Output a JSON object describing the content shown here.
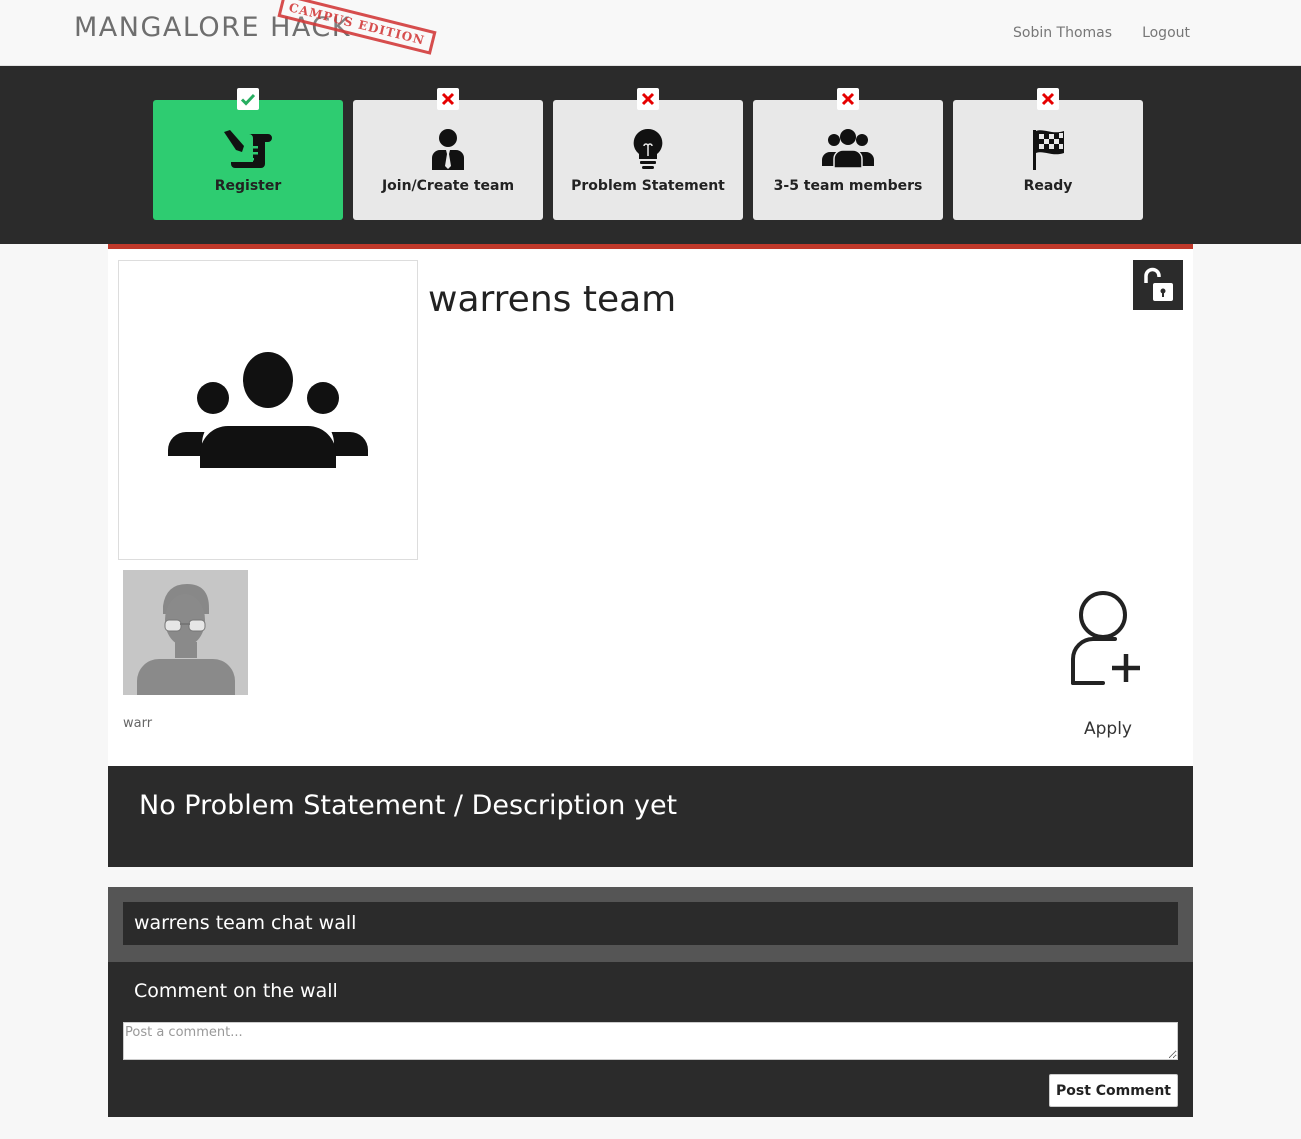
{
  "header": {
    "brand": "MANGALORE HACK",
    "stamp": "CAMPUS EDITION",
    "user_name": "Sobin Thomas",
    "logout_label": "Logout"
  },
  "steps": [
    {
      "label": "Register",
      "status": "done",
      "icon": "register-scroll-icon"
    },
    {
      "label": "Join/Create team",
      "status": "pending",
      "icon": "person-icon"
    },
    {
      "label": "Problem Statement",
      "status": "pending",
      "icon": "lightbulb-icon"
    },
    {
      "label": "3-5 team members",
      "status": "pending",
      "icon": "group-icon"
    },
    {
      "label": "Ready",
      "status": "pending",
      "icon": "checkered-flag-icon"
    }
  ],
  "colors": {
    "accent_done": "#2ecc71",
    "pending_mark": "#e60000",
    "done_mark": "#27ae60",
    "card_top_border": "#c0392b",
    "dark_bg": "#2b2b2b"
  },
  "team": {
    "name": "warrens team",
    "lock_icon": "unlock-icon",
    "members": [
      {
        "name": "warr"
      }
    ],
    "apply_label": "Apply"
  },
  "problem": {
    "title": "No Problem Statement / Description yet"
  },
  "chat": {
    "title": "warrens team chat wall",
    "comment_label": "Comment on the wall",
    "comment_value": "",
    "comment_placeholder": "Post a comment...",
    "post_button": "Post Comment"
  }
}
